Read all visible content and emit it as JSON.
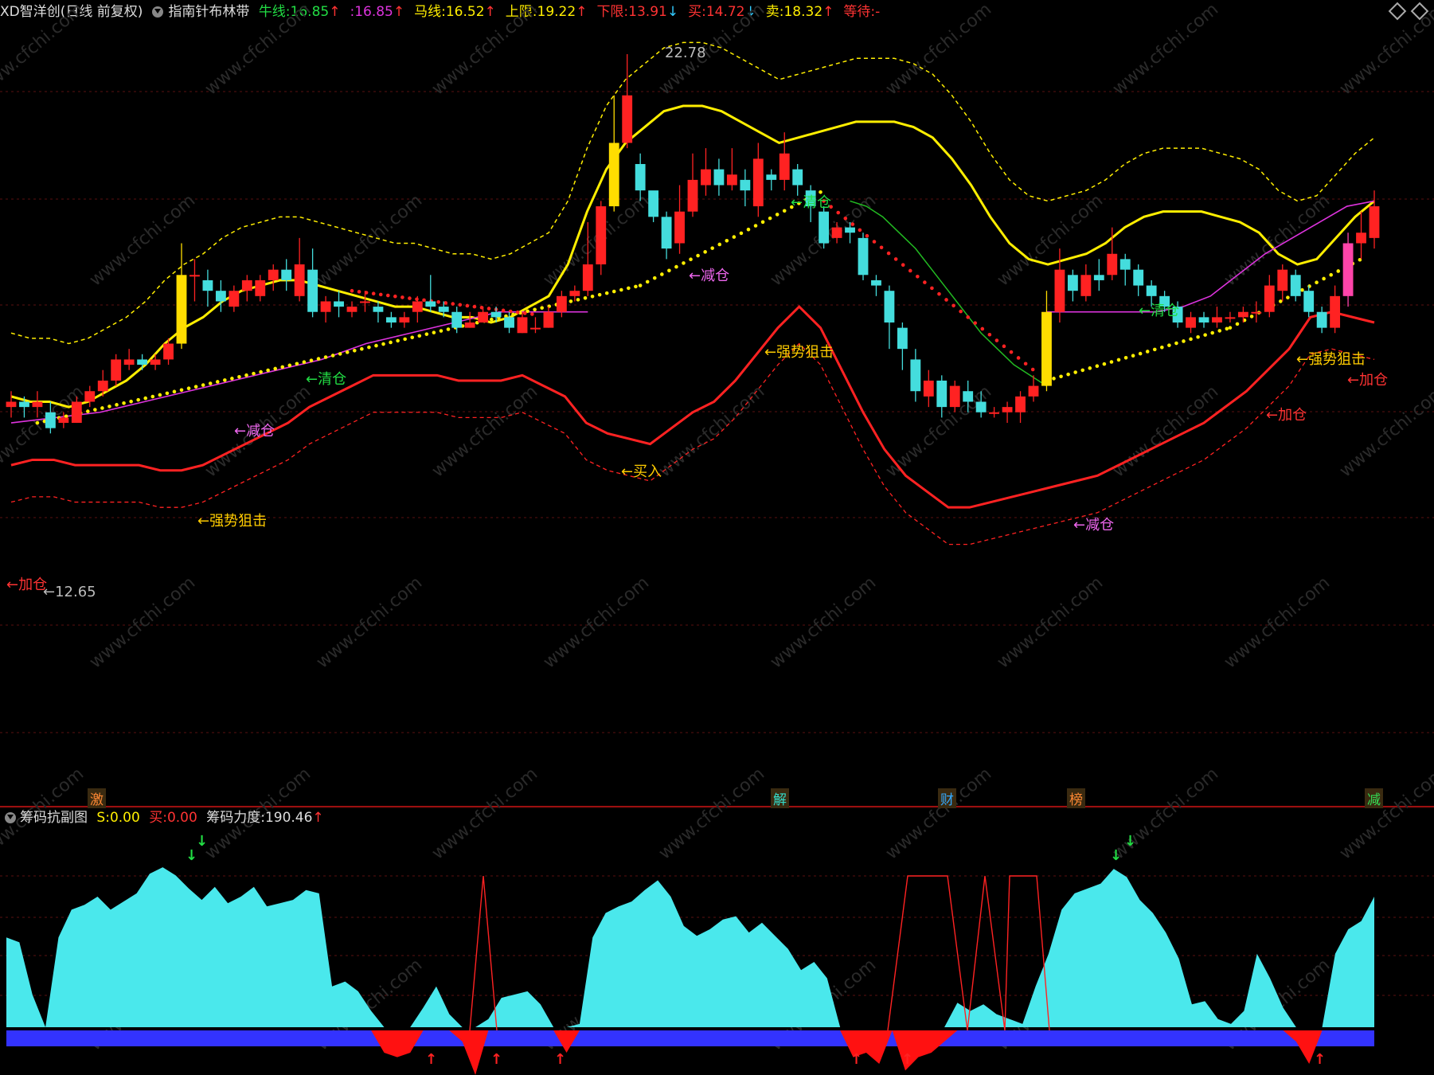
{
  "header": {
    "app": "XD智洋创(日线 前复权)",
    "indicator": "指南针布林带",
    "items": [
      {
        "label": "牛线:",
        "value": "16.85",
        "arrow": "↑",
        "color": "#22dd44",
        "arrow_color": "#ff3333"
      },
      {
        "label": ":",
        "value": "16.85",
        "arrow": "↑",
        "color": "#dd33dd",
        "arrow_color": "#ff3333"
      },
      {
        "label": "马线:",
        "value": "16.52",
        "arrow": "↑",
        "color": "#ffee00",
        "arrow_color": "#ff3333"
      },
      {
        "label": "上限:",
        "value": "19.22",
        "arrow": "↑",
        "color": "#ffee00",
        "arrow_color": "#ff3333"
      },
      {
        "label": "下限:",
        "value": "13.91",
        "arrow": "↓",
        "color": "#ff3333",
        "arrow_color": "#33ccff"
      },
      {
        "label": "买:",
        "value": "14.72",
        "arrow": "↓",
        "color": "#ff3333",
        "arrow_color": "#33ccff"
      },
      {
        "label": "卖:",
        "value": "18.32",
        "arrow": "↑",
        "color": "#ffee00",
        "arrow_color": "#ff3333"
      },
      {
        "label": "等待:",
        "value": "-",
        "arrow": "",
        "color": "#ff3333",
        "arrow_color": "#ff3333"
      }
    ]
  },
  "price_labels": {
    "high": "22.78",
    "low": "←12.65"
  },
  "signals": [
    {
      "text": "←清仓",
      "color": "#22dd44"
    },
    {
      "text": "←减仓",
      "color": "#ee66ee"
    },
    {
      "text": "←强势狙击",
      "color": "#ffcc00"
    },
    {
      "text": "←加仓",
      "color": "#ff3333"
    },
    {
      "text": "←买入",
      "color": "#ffcc00"
    },
    {
      "text": "←清仓",
      "color": "#22dd44"
    },
    {
      "text": "←减仓",
      "color": "#ee66ee"
    },
    {
      "text": "←强势狙击",
      "color": "#ffcc00"
    },
    {
      "text": "←减仓",
      "color": "#ee66ee"
    },
    {
      "text": "←清仓",
      "color": "#22dd44"
    },
    {
      "text": "←强势狙击",
      "color": "#ffcc00"
    },
    {
      "text": "←加仓",
      "color": "#ff3333"
    },
    {
      "text": "←加仓",
      "color": "#ff3333"
    }
  ],
  "date_tags": [
    {
      "text": "激",
      "color": "#ff8833"
    },
    {
      "text": "解",
      "color": "#33ddcc"
    },
    {
      "text": "财",
      "color": "#33aaff"
    },
    {
      "text": "榜",
      "color": "#ff8833"
    },
    {
      "text": "减",
      "color": "#33dd55"
    }
  ],
  "sub_header": {
    "name": "筹码抗副图",
    "s_label": "S:",
    "s_value": "0.00",
    "buy_label": "买:",
    "buy_value": "0.00",
    "force_label": "筹码力度:",
    "force_value": "190.46",
    "force_arrow": "↑"
  },
  "watermark": "www.cfchi.com",
  "colors": {
    "up": "#ff2222",
    "down": "#44dddd",
    "upper": "#ffee00",
    "lower": "#ff2222",
    "mid": "#dd33dd",
    "sub_area": "#4ae8ec",
    "sub_base": "#3333ff"
  },
  "chart_data": {
    "type": "candlestick",
    "y_range": [
      12.65,
      22.78
    ],
    "candles": [
      [
        16.1,
        16.2,
        16.4,
        15.9
      ],
      [
        16.2,
        16.1,
        16.3,
        15.9
      ],
      [
        16.1,
        16.2,
        16.4,
        15.9
      ],
      [
        16.0,
        15.7,
        16.2,
        15.6
      ],
      [
        15.8,
        15.9,
        16.0,
        15.7
      ],
      [
        15.8,
        16.2,
        16.3,
        15.8
      ],
      [
        16.2,
        16.4,
        16.5,
        16.1
      ],
      [
        16.4,
        16.6,
        16.8,
        16.3
      ],
      [
        16.6,
        17.0,
        17.1,
        16.5
      ],
      [
        16.9,
        17.0,
        17.2,
        16.8
      ],
      [
        17.0,
        16.9,
        17.1,
        16.8
      ],
      [
        16.9,
        17.0,
        17.1,
        16.8
      ],
      [
        17.0,
        17.3,
        17.4,
        16.9
      ],
      [
        17.3,
        18.6,
        19.2,
        17.2
      ],
      [
        18.6,
        18.6,
        18.9,
        18.1
      ],
      [
        18.5,
        18.3,
        18.7,
        18.0
      ],
      [
        18.3,
        18.1,
        18.5,
        17.9
      ],
      [
        18.0,
        18.3,
        18.4,
        17.9
      ],
      [
        18.3,
        18.5,
        18.6,
        18.1
      ],
      [
        18.2,
        18.5,
        18.6,
        18.1
      ],
      [
        18.5,
        18.7,
        18.8,
        18.3
      ],
      [
        18.7,
        18.5,
        18.9,
        18.3
      ],
      [
        18.2,
        18.8,
        19.3,
        18.1
      ],
      [
        18.7,
        17.9,
        19.1,
        17.8
      ],
      [
        17.9,
        18.1,
        18.2,
        17.7
      ],
      [
        18.1,
        18.0,
        18.3,
        17.8
      ],
      [
        17.9,
        18.0,
        18.1,
        17.8
      ],
      [
        18.1,
        18.1,
        18.3,
        17.9
      ],
      [
        18.0,
        17.9,
        18.1,
        17.7
      ],
      [
        17.8,
        17.7,
        17.9,
        17.6
      ],
      [
        17.7,
        17.8,
        17.9,
        17.6
      ],
      [
        17.9,
        18.1,
        18.2,
        17.7
      ],
      [
        18.1,
        18.0,
        18.6,
        17.9
      ],
      [
        18.0,
        17.9,
        18.1,
        17.8
      ],
      [
        17.9,
        17.6,
        18.0,
        17.5
      ],
      [
        17.6,
        17.7,
        17.9,
        17.6
      ],
      [
        17.7,
        17.9,
        18.0,
        17.7
      ],
      [
        17.9,
        17.8,
        18.0,
        17.7
      ],
      [
        17.8,
        17.6,
        17.9,
        17.5
      ],
      [
        17.5,
        17.8,
        17.9,
        17.5
      ],
      [
        17.6,
        17.6,
        17.8,
        17.5
      ],
      [
        17.6,
        17.9,
        18.0,
        17.6
      ],
      [
        17.9,
        18.2,
        18.3,
        17.8
      ],
      [
        18.2,
        18.3,
        18.4,
        18.1
      ],
      [
        18.3,
        18.8,
        19.6,
        18.2
      ],
      [
        18.8,
        19.9,
        20.0,
        18.6
      ],
      [
        19.9,
        21.1,
        22.0,
        19.8
      ],
      [
        21.1,
        22.0,
        22.78,
        21.0
      ],
      [
        20.7,
        20.2,
        20.9,
        20.0
      ],
      [
        20.2,
        19.7,
        20.1,
        19.6
      ],
      [
        19.7,
        19.1,
        19.8,
        18.9
      ],
      [
        19.2,
        19.8,
        20.3,
        19.0
      ],
      [
        19.8,
        20.4,
        20.9,
        19.7
      ],
      [
        20.3,
        20.6,
        21.0,
        20.1
      ],
      [
        20.6,
        20.3,
        20.8,
        20.1
      ],
      [
        20.3,
        20.5,
        21.0,
        20.2
      ],
      [
        20.4,
        20.2,
        20.6,
        19.9
      ],
      [
        19.9,
        20.8,
        21.1,
        19.7
      ],
      [
        20.5,
        20.4,
        20.6,
        20.2
      ],
      [
        20.4,
        20.9,
        21.3,
        20.2
      ],
      [
        20.6,
        20.3,
        20.7,
        20.1
      ],
      [
        20.2,
        19.9,
        20.3,
        19.6
      ],
      [
        19.8,
        19.2,
        19.9,
        19.1
      ],
      [
        19.3,
        19.5,
        19.6,
        19.2
      ],
      [
        19.5,
        19.4,
        19.6,
        19.2
      ],
      [
        19.3,
        18.6,
        19.4,
        18.5
      ],
      [
        18.5,
        18.4,
        18.6,
        18.2
      ],
      [
        18.3,
        17.7,
        18.4,
        17.2
      ],
      [
        17.6,
        17.2,
        17.7,
        16.8
      ],
      [
        17.0,
        16.4,
        17.2,
        16.2
      ],
      [
        16.3,
        16.6,
        16.8,
        16.1
      ],
      [
        16.6,
        16.1,
        16.7,
        15.9
      ],
      [
        16.1,
        16.5,
        16.6,
        16.0
      ],
      [
        16.4,
        16.2,
        16.6,
        16.0
      ],
      [
        16.2,
        16.0,
        16.4,
        15.9
      ],
      [
        16.0,
        16.0,
        16.1,
        15.9
      ],
      [
        16.0,
        16.1,
        16.2,
        15.8
      ],
      [
        16.0,
        16.3,
        16.4,
        15.8
      ],
      [
        16.3,
        16.5,
        16.7,
        16.2
      ],
      [
        16.5,
        17.9,
        18.3,
        16.4
      ],
      [
        17.9,
        18.7,
        19.1,
        17.7
      ],
      [
        18.6,
        18.3,
        18.7,
        18.1
      ],
      [
        18.2,
        18.6,
        18.8,
        18.1
      ],
      [
        18.6,
        18.5,
        18.9,
        18.3
      ],
      [
        18.6,
        19.0,
        19.5,
        18.5
      ],
      [
        18.9,
        18.7,
        19.0,
        18.4
      ],
      [
        18.7,
        18.4,
        18.8,
        18.2
      ],
      [
        18.4,
        18.2,
        18.5,
        18.0
      ],
      [
        18.2,
        18.0,
        18.3,
        17.9
      ],
      [
        18.0,
        17.7,
        18.1,
        17.6
      ],
      [
        17.6,
        17.8,
        17.9,
        17.5
      ],
      [
        17.8,
        17.7,
        17.9,
        17.6
      ],
      [
        17.7,
        17.8,
        18.0,
        17.6
      ],
      [
        17.8,
        17.8,
        17.9,
        17.7
      ],
      [
        17.8,
        17.9,
        18.0,
        17.7
      ],
      [
        17.9,
        17.9,
        18.1,
        17.7
      ],
      [
        17.9,
        18.4,
        18.6,
        17.8
      ],
      [
        18.3,
        18.7,
        18.8,
        18.1
      ],
      [
        18.6,
        18.2,
        18.7,
        18.1
      ],
      [
        18.3,
        17.9,
        18.4,
        17.8
      ],
      [
        17.9,
        17.6,
        18.0,
        17.5
      ],
      [
        17.6,
        18.2,
        18.4,
        17.5
      ],
      [
        18.2,
        19.2,
        19.4,
        18.0
      ],
      [
        19.2,
        19.4,
        19.8,
        18.9
      ],
      [
        19.3,
        19.9,
        20.2,
        19.1
      ]
    ],
    "upper": [
      16.3,
      16.2,
      16.2,
      16.1,
      16.2,
      16.4,
      16.6,
      16.9,
      17.3,
      17.6,
      17.8,
      18.1,
      18.3,
      18.4,
      18.5,
      18.5,
      18.4,
      18.3,
      18.2,
      18.1,
      18.0,
      18.0,
      17.9,
      17.8,
      17.8,
      17.7,
      17.8,
      18.0,
      18.2,
      18.8,
      19.8,
      20.6,
      21.1,
      21.4,
      21.7,
      21.8,
      21.8,
      21.7,
      21.5,
      21.3,
      21.1,
      21.2,
      21.3,
      21.4,
      21.5,
      21.5,
      21.5,
      21.4,
      21.2,
      20.8,
      20.3,
      19.7,
      19.2,
      18.9,
      18.8,
      18.9,
      19.0,
      19.2,
      19.5,
      19.7,
      19.8,
      19.8,
      19.8,
      19.7,
      19.6,
      19.4,
      19.0,
      18.8,
      18.9,
      19.3,
      19.7,
      20.0
    ],
    "lower": [
      15.0,
      15.1,
      15.1,
      15.0,
      15.0,
      15.0,
      15.0,
      14.9,
      14.9,
      15.0,
      15.2,
      15.4,
      15.6,
      15.8,
      16.1,
      16.3,
      16.5,
      16.7,
      16.7,
      16.7,
      16.7,
      16.6,
      16.6,
      16.6,
      16.7,
      16.5,
      16.3,
      15.8,
      15.6,
      15.5,
      15.4,
      15.7,
      16.0,
      16.2,
      16.6,
      17.1,
      17.6,
      18.0,
      17.6,
      16.8,
      16.0,
      15.3,
      14.8,
      14.5,
      14.2,
      14.2,
      14.3,
      14.4,
      14.5,
      14.6,
      14.7,
      14.8,
      15.0,
      15.2,
      15.4,
      15.6,
      15.8,
      16.1,
      16.4,
      16.8,
      17.2,
      17.8,
      17.9,
      17.8,
      17.7
    ],
    "mid": [
      15.8,
      15.9,
      16.0,
      16.2,
      16.4,
      16.6,
      16.8,
      17.0,
      17.3,
      17.5,
      17.7,
      17.9,
      17.9,
      17.9,
      17.9,
      17.9,
      17.9,
      17.9,
      17.9,
      18.0,
      18.2,
      18.6,
      19.0,
      19.3,
      19.6,
      19.9,
      20.0
    ],
    "green_line": [
      20.0,
      19.9,
      19.7,
      19.4,
      19.1,
      18.7,
      18.3,
      17.9,
      17.5,
      17.2,
      16.9,
      16.7,
      16.5
    ],
    "sub_values": [
      0.55,
      0.52,
      0.2,
      0.0,
      0.55,
      0.72,
      0.75,
      0.8,
      0.72,
      0.77,
      0.82,
      0.94,
      0.98,
      0.93,
      0.85,
      0.78,
      0.86,
      0.76,
      0.8,
      0.86,
      0.74,
      0.76,
      0.78,
      0.84,
      0.82,
      0.25,
      0.28,
      0.22,
      0.1,
      -0.1,
      -0.12,
      -0.1,
      0.12,
      0.25,
      0.08,
      -0.05,
      -0.2,
      0.05,
      0.18,
      0.2,
      0.22,
      0.14,
      0.0,
      -0.1,
      0.02,
      0.55,
      0.7,
      0.74,
      0.77,
      0.84,
      0.9,
      0.8,
      0.62,
      0.56,
      0.6,
      0.66,
      0.68,
      0.58,
      0.64,
      0.56,
      0.48,
      0.35,
      0.4,
      0.3,
      0.0,
      -0.12,
      -0.1,
      -0.15,
      0.0,
      -0.18,
      -0.12,
      -0.1,
      -0.05,
      0.15,
      0.1,
      0.14,
      0.08,
      0.05,
      0.02,
      0.25,
      0.45,
      0.72,
      0.82,
      0.85,
      0.88,
      0.97,
      0.92,
      0.78,
      0.7,
      0.58,
      0.42,
      0.14,
      0.16,
      0.05,
      0.02,
      0.1,
      0.45,
      0.3,
      0.12,
      -0.05,
      -0.15,
      0.0,
      0.45,
      0.6,
      0.65,
      0.8
    ]
  }
}
